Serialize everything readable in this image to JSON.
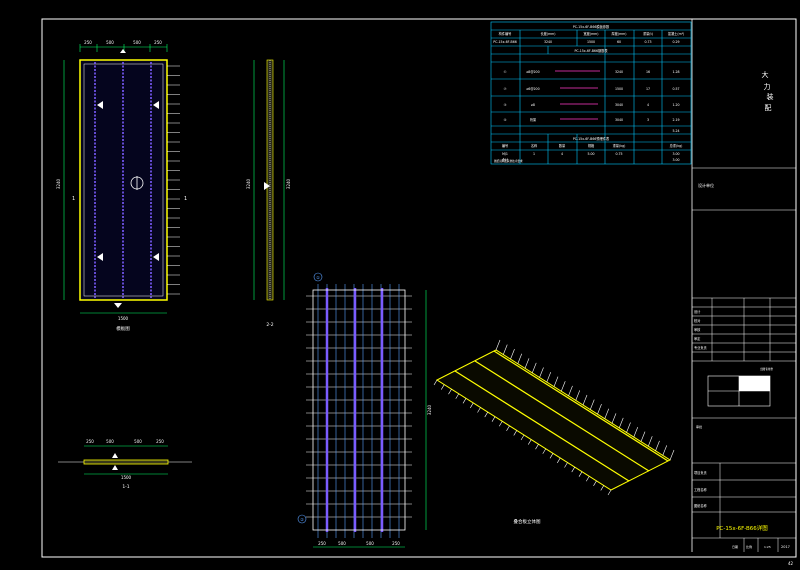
{
  "drawing": {
    "colors": {
      "background": "#000000",
      "frame": "#ffffff",
      "slab_outline": "#ffff00",
      "rebar_vertical": "#7b5cff",
      "rebar_horizontal": "#ffffff",
      "lattice": "#5aa0ff",
      "table_lines": "#00c8ff",
      "dimension": "#00ff66",
      "title_block_text": "#ffff00",
      "sheet_number": "#ffffff"
    },
    "plan_view": {
      "top_dims": [
        "250",
        "500",
        "500",
        "250"
      ],
      "left_dim": "3240",
      "bottom_dim": "1500",
      "caption": "模板图",
      "section_mark": "1",
      "marker_a": "A",
      "marker_b": "B"
    },
    "side_view": {
      "left_dim": "3240",
      "right_dim": "3240",
      "caption": "2-2"
    },
    "section_view": {
      "top_dims": [
        "250",
        "500",
        "500",
        "250"
      ],
      "bottom_dim": "1500",
      "caption": "1-1"
    },
    "rebar_view": {
      "side_dim": "3240",
      "bottom_dims": [
        "250",
        "500",
        "500",
        "250"
      ],
      "bubble_top": "①",
      "bubble_bottom": "②"
    },
    "iso_view": {
      "caption": "叠合板立体图"
    },
    "table": {
      "title_1": "PC-15x-6F-B66模板参数",
      "headers_1": [
        "构件编号",
        "长度(mm)",
        "宽度(mm)",
        "厚度(mm)",
        "重量(t)",
        "混凝土(m³)",
        "预制方向"
      ],
      "row_1": [
        "PC-15x-6F-B66",
        "3240",
        "1500",
        "60",
        "0.73",
        "0.29",
        "横向"
      ],
      "title_2": "PC-15x-6F-B66钢筋表",
      "rows_2": [
        [
          "①",
          "⌀8@200",
          "",
          "3240",
          "16",
          "1.28"
        ],
        [
          "②",
          "⌀6@200",
          "",
          "1500",
          "17",
          "0.57"
        ],
        [
          "③",
          "⌀8",
          "",
          "3040",
          "4",
          "1.20"
        ],
        [
          "④",
          "桁架",
          "",
          "3040",
          "3",
          "2.19"
        ]
      ],
      "row_2_total": "5.24",
      "title_3": "PC-15x-6F-B66预埋件表",
      "headers_3": [
        "编号",
        "名称",
        "数量",
        "规格",
        "重量(kg)",
        "总重(kg)"
      ],
      "row_3a": [
        "MJ1",
        "1",
        "4",
        "5.00",
        "0.75",
        "3.00"
      ],
      "row_3b": [
        "合计",
        "",
        "",
        "",
        "",
        "3.00"
      ]
    },
    "title_block": {
      "vertical_text": [
        "大",
        "力",
        "装",
        "配"
      ],
      "note_small": "图纸说明及其他技术要求",
      "project_label": "设计单位",
      "drawing_name": "PC-15x-6F-B66详图",
      "scale_label": "比例",
      "scale_value": "1:25",
      "date_label": "日期",
      "date_value": "2017",
      "sheet_no": "42",
      "rows": [
        "设计",
        "校对",
        "审核",
        "审定",
        "专业负责"
      ],
      "rows_lower": [
        "项目负责",
        "工程名称",
        "图纸名称"
      ],
      "approval": "审批",
      "stamp_text": "出图专用章"
    }
  }
}
